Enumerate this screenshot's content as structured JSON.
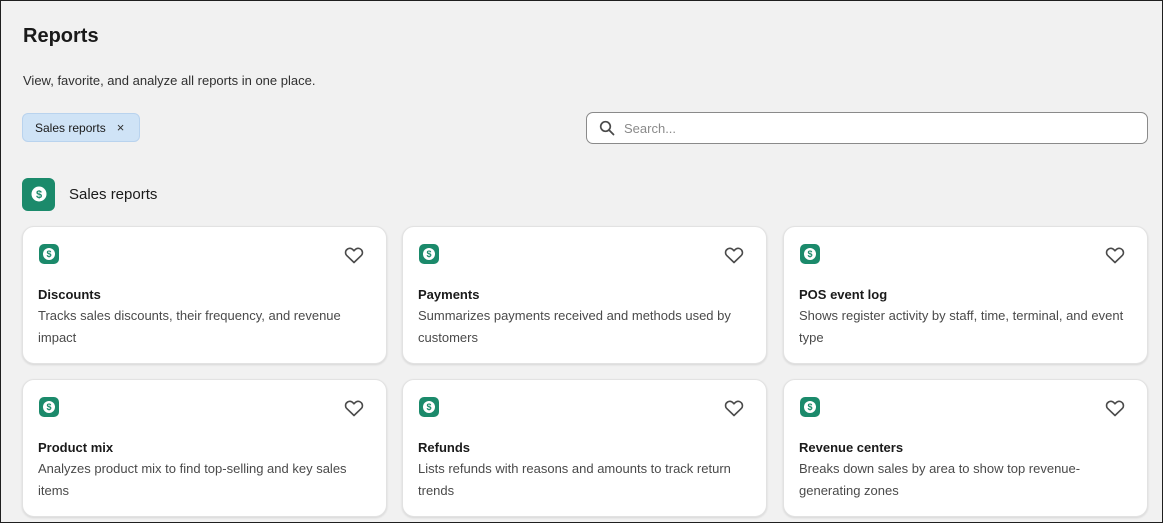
{
  "page": {
    "title": "Reports",
    "subtitle": "View, favorite, and analyze all reports in one place."
  },
  "filter_chip": {
    "label": "Sales reports",
    "remove_glyph": "×"
  },
  "search": {
    "placeholder": "Search...",
    "value": ""
  },
  "section": {
    "title": "Sales reports",
    "icon": "dollar-icon"
  },
  "colors": {
    "accent": "#1b8a6b",
    "chip_bg": "#cfe3f6",
    "background": "#f1f1f1"
  },
  "cards": [
    {
      "title": "Discounts",
      "description": "Tracks sales discounts, their frequency, and revenue impact",
      "icon": "dollar-icon",
      "favorite": false
    },
    {
      "title": "Payments",
      "description": "Summarizes payments received and methods used by customers",
      "icon": "dollar-icon",
      "favorite": false
    },
    {
      "title": "POS event log",
      "description": "Shows register activity by staff, time, terminal, and event type",
      "icon": "dollar-icon",
      "favorite": false
    },
    {
      "title": "Product mix",
      "description": "Analyzes product mix to find top-selling and key sales items",
      "icon": "dollar-icon",
      "favorite": false
    },
    {
      "title": "Refunds",
      "description": "Lists refunds with reasons and amounts to track return trends",
      "icon": "dollar-icon",
      "favorite": false
    },
    {
      "title": "Revenue centers",
      "description": "Breaks down sales by area to show top revenue-generating zones",
      "icon": "dollar-icon",
      "favorite": false
    }
  ]
}
